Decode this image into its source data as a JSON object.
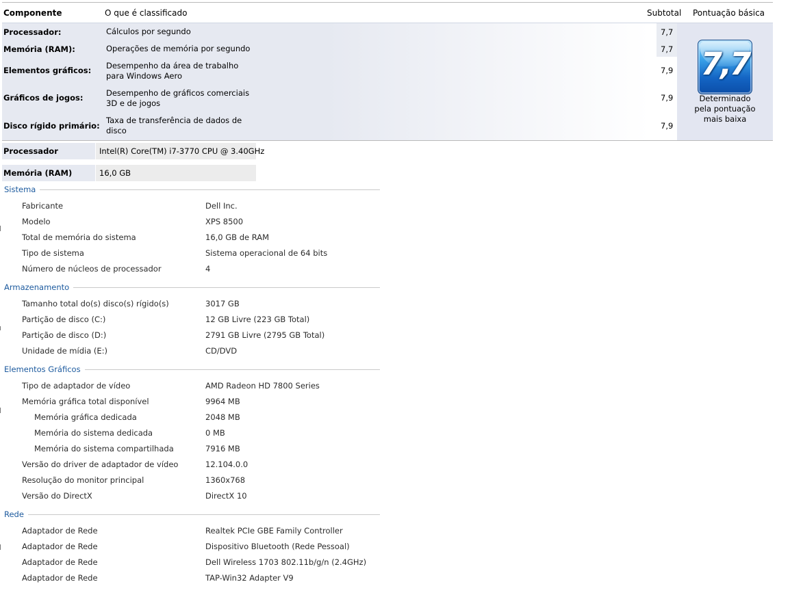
{
  "score_table": {
    "headers": {
      "component": "Componente",
      "classified": "O que é classificado",
      "subtotal": "Subtotal",
      "base_score": "Pontuação básica"
    },
    "rows": [
      {
        "component": "Processador:",
        "desc_lines": [
          "Cálculos por segundo"
        ],
        "subtotal": "7,7"
      },
      {
        "component": "Memória (RAM):",
        "desc_lines": [
          "Operações de memória por segundo"
        ],
        "subtotal": "7,7"
      },
      {
        "component": "Elementos gráficos:",
        "desc_lines": [
          "Desempenho da área de trabalho",
          "para Windows Aero"
        ],
        "subtotal": "7,9"
      },
      {
        "component": "Gráficos de jogos:",
        "desc_lines": [
          "Desempenho de gráficos comerciais",
          "3D e de jogos"
        ],
        "subtotal": "7,9"
      },
      {
        "component": "Disco rígido primário:",
        "desc_lines": [
          "Taxa de transferência de dados de",
          "disco"
        ],
        "subtotal": "7,9"
      }
    ],
    "base_score": {
      "value": "7,7",
      "caption_lines": [
        "Determinado",
        "pela pontuação",
        "mais baixa"
      ]
    }
  },
  "summary": {
    "processor": {
      "label": "Processador",
      "value": "Intel(R) Core(TM) i7-3770 CPU @ 3.40GHz"
    },
    "memory": {
      "label": "Memória (RAM)",
      "value": "16,0 GB"
    }
  },
  "sections": {
    "sistema": {
      "title": "Sistema",
      "rows": [
        {
          "k": "Fabricante",
          "v": "Dell Inc."
        },
        {
          "k": "Modelo",
          "v": "XPS 8500"
        },
        {
          "k": "Total de memória do sistema",
          "v": "16,0 GB de RAM"
        },
        {
          "k": "Tipo de sistema",
          "v": "Sistema operacional de 64 bits"
        },
        {
          "k": "Número de núcleos de processador",
          "v": "4"
        }
      ]
    },
    "armazenamento": {
      "title": "Armazenamento",
      "rows": [
        {
          "k": "Tamanho total do(s) disco(s) rígido(s)",
          "v": "3017 GB"
        },
        {
          "k": "Partição de disco (C:)",
          "v": "12 GB Livre (223 GB Total)"
        },
        {
          "k": "Partição de disco (D:)",
          "v": "2791 GB Livre (2795 GB Total)"
        },
        {
          "k": "Unidade de mídia (E:)",
          "v": "CD/DVD"
        }
      ]
    },
    "graficos": {
      "title": "Elementos Gráficos",
      "rows": [
        {
          "k": "Tipo de adaptador de vídeo",
          "v": "AMD Radeon HD 7800 Series"
        },
        {
          "k": "Memória gráfica total disponível",
          "v": "9964 MB"
        },
        {
          "k": "Memória gráfica dedicada",
          "v": "2048 MB"
        },
        {
          "k": "Memória do sistema dedicada",
          "v": "0 MB"
        },
        {
          "k": "Memória do sistema compartilhada",
          "v": "7916 MB"
        },
        {
          "k": "Versão do driver de adaptador de vídeo",
          "v": "12.104.0.0"
        },
        {
          "k": "Resolução do monitor principal",
          "v": "1360x768"
        },
        {
          "k": "Versão do DirectX",
          "v": "DirectX 10"
        }
      ]
    },
    "rede": {
      "title": "Rede",
      "rows": [
        {
          "k": "Adaptador de Rede",
          "v": "Realtek PCIe GBE Family Controller"
        },
        {
          "k": "Adaptador de Rede",
          "v": "Dispositivo Bluetooth (Rede Pessoal)"
        },
        {
          "k": "Adaptador de Rede",
          "v": "Dell Wireless 1703 802.11b/g/n (2.4GHz)"
        },
        {
          "k": "Adaptador de Rede",
          "v": "TAP-Win32 Adapter V9"
        }
      ]
    }
  }
}
